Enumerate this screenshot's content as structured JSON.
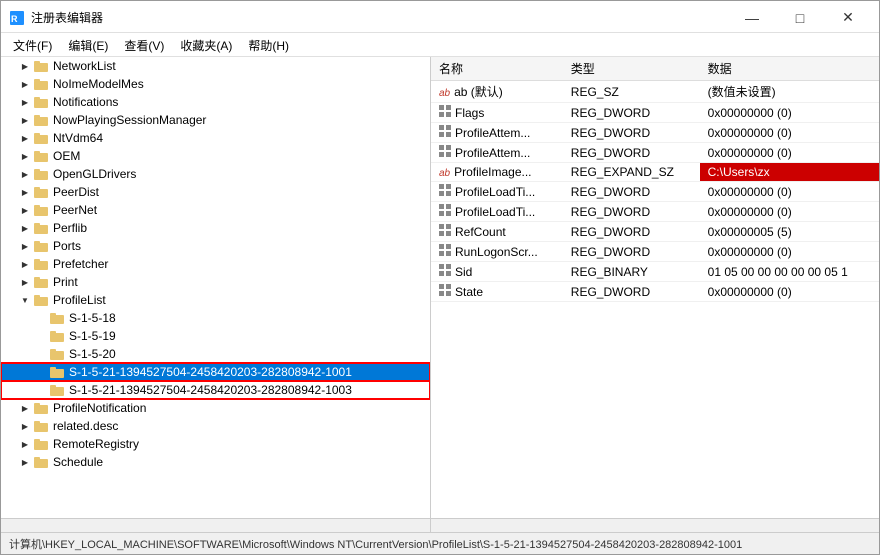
{
  "window": {
    "title": "注册表编辑器",
    "controls": {
      "minimize": "—",
      "maximize": "□",
      "close": "✕"
    }
  },
  "menu": {
    "items": [
      "文件(F)",
      "编辑(E)",
      "查看(V)",
      "收藏夹(A)",
      "帮助(H)"
    ]
  },
  "tree": {
    "items": [
      {
        "id": "networkList",
        "label": "NetworkList",
        "indent": 1,
        "expand": "closed"
      },
      {
        "id": "noImeModelMes",
        "label": "NoImeModelMes",
        "indent": 1,
        "expand": "closed"
      },
      {
        "id": "notifications",
        "label": "Notifications",
        "indent": 1,
        "expand": "closed"
      },
      {
        "id": "nowPlayingSessionManager",
        "label": "NowPlayingSessionManager",
        "indent": 1,
        "expand": "closed"
      },
      {
        "id": "ntVdm64",
        "label": "NtVdm64",
        "indent": 1,
        "expand": "closed"
      },
      {
        "id": "oem",
        "label": "OEM",
        "indent": 1,
        "expand": "closed"
      },
      {
        "id": "openGLDrivers",
        "label": "OpenGLDrivers",
        "indent": 1,
        "expand": "closed"
      },
      {
        "id": "peerDist",
        "label": "PeerDist",
        "indent": 1,
        "expand": "closed"
      },
      {
        "id": "peerNet",
        "label": "PeerNet",
        "indent": 1,
        "expand": "closed"
      },
      {
        "id": "perflib",
        "label": "Perflib",
        "indent": 1,
        "expand": "closed"
      },
      {
        "id": "ports",
        "label": "Ports",
        "indent": 1,
        "expand": "closed"
      },
      {
        "id": "prefetcher",
        "label": "Prefetcher",
        "indent": 1,
        "expand": "closed"
      },
      {
        "id": "print",
        "label": "Print",
        "indent": 1,
        "expand": "closed"
      },
      {
        "id": "profileList",
        "label": "ProfileList",
        "indent": 1,
        "expand": "open"
      },
      {
        "id": "s1518",
        "label": "S-1-5-18",
        "indent": 2,
        "expand": "leaf"
      },
      {
        "id": "s1519",
        "label": "S-1-5-19",
        "indent": 2,
        "expand": "leaf"
      },
      {
        "id": "s1520",
        "label": "S-1-5-20",
        "indent": 2,
        "expand": "leaf"
      },
      {
        "id": "s15211001",
        "label": "S-1-5-21-1394527504-2458420203-282808942-1001",
        "indent": 2,
        "expand": "leaf",
        "highlighted": true,
        "selected": true
      },
      {
        "id": "s15211003",
        "label": "S-1-5-21-1394527504-2458420203-282808942-1003",
        "indent": 2,
        "expand": "leaf",
        "highlighted": true
      },
      {
        "id": "profileNotification",
        "label": "ProfileNotification",
        "indent": 1,
        "expand": "closed"
      },
      {
        "id": "relatedDesc",
        "label": "related.desc",
        "indent": 1,
        "expand": "closed"
      },
      {
        "id": "remoteRegistry",
        "label": "RemoteRegistry",
        "indent": 1,
        "expand": "closed"
      },
      {
        "id": "schedule",
        "label": "Schedule",
        "indent": 1,
        "expand": "closed"
      }
    ]
  },
  "registry_table": {
    "columns": [
      "名称",
      "类型",
      "数据"
    ],
    "rows": [
      {
        "name": "ab (默认)",
        "type": "REG_SZ",
        "data": "(数值未设置)",
        "icon": "ab"
      },
      {
        "name": "Flags",
        "type": "REG_DWORD",
        "data": "0x00000000 (0)",
        "icon": "grid"
      },
      {
        "name": "ProfileAttem...",
        "type": "REG_DWORD",
        "data": "0x00000000 (0)",
        "icon": "grid"
      },
      {
        "name": "ProfileAttem...",
        "type": "REG_DWORD",
        "data": "0x00000000 (0)",
        "icon": "grid"
      },
      {
        "name": "ProfileImage...",
        "type": "REG_EXPAND_SZ",
        "data": "C:\\Users\\zx",
        "icon": "ab",
        "highlightData": true
      },
      {
        "name": "ProfileLoadTi...",
        "type": "REG_DWORD",
        "data": "0x00000000 (0)",
        "icon": "grid"
      },
      {
        "name": "ProfileLoadTi...",
        "type": "REG_DWORD",
        "data": "0x00000000 (0)",
        "icon": "grid"
      },
      {
        "name": "RefCount",
        "type": "REG_DWORD",
        "data": "0x00000005 (5)",
        "icon": "grid"
      },
      {
        "name": "RunLogonScr...",
        "type": "REG_DWORD",
        "data": "0x00000000 (0)",
        "icon": "grid"
      },
      {
        "name": "Sid",
        "type": "REG_BINARY",
        "data": "01 05 00 00 00 00 00 05 1",
        "icon": "grid"
      },
      {
        "name": "State",
        "type": "REG_DWORD",
        "data": "0x00000000 (0)",
        "icon": "grid"
      }
    ]
  },
  "status_bar": {
    "text": "计算机\\HKEY_LOCAL_MACHINE\\SOFTWARE\\Microsoft\\Windows NT\\CurrentVersion\\ProfileList\\S-1-5-21-1394527504-2458420203-282808942-1001"
  }
}
